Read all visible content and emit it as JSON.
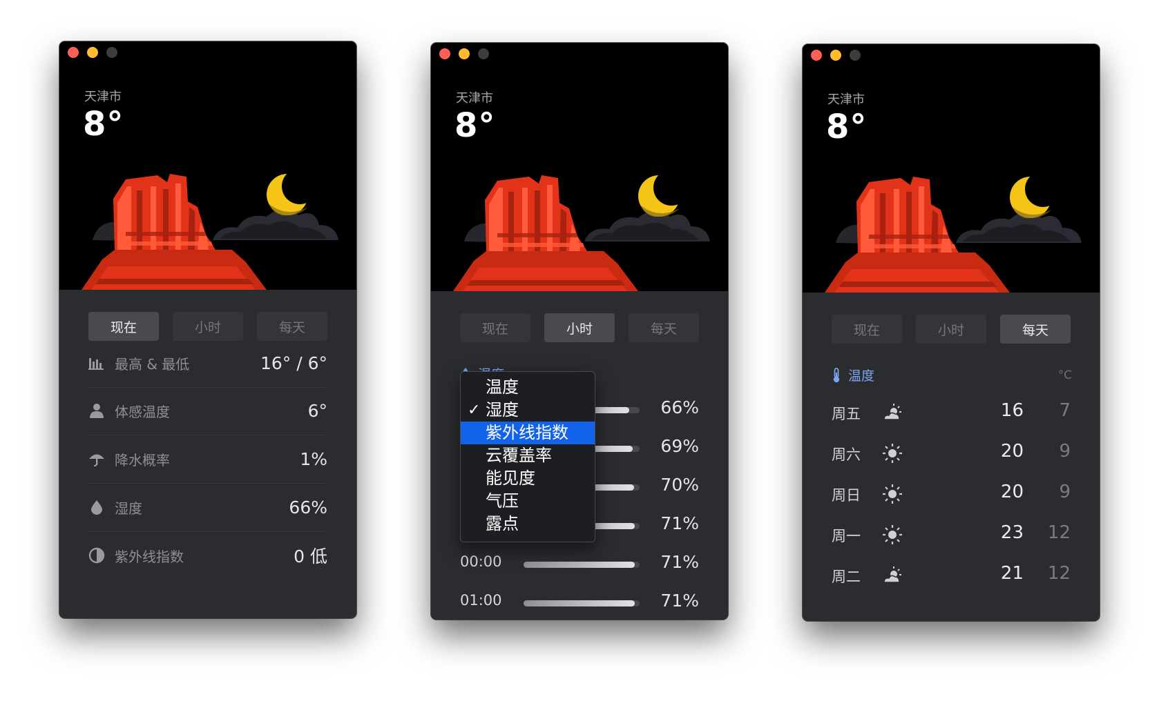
{
  "colors": {
    "window_bg": "#2b2c30",
    "hero_bg": "#000000",
    "accent_blue": "#7ba4f4",
    "menu_highlight": "#1362ea",
    "rock_red": "#e2331a",
    "moon_yellow": "#f4c516"
  },
  "windows": [
    {
      "city": "天津市",
      "temperature": "8°",
      "tabs": [
        {
          "label": "现在",
          "active": true
        },
        {
          "label": "小时",
          "active": false
        },
        {
          "label": "每天",
          "active": false
        }
      ],
      "rows": [
        {
          "icon": "bar-chart-icon",
          "label": "最高 & 最低",
          "value": "16° / 6°"
        },
        {
          "icon": "person-icon",
          "label": "体感温度",
          "value": "6°"
        },
        {
          "icon": "umbrella-icon",
          "label": "降水概率",
          "value": "1%"
        },
        {
          "icon": "drop-icon",
          "label": "湿度",
          "value": "66%"
        },
        {
          "icon": "half-circle-icon",
          "label": "紫外线指数",
          "value": "0 低"
        }
      ]
    },
    {
      "city": "天津市",
      "temperature": "8°",
      "tabs": [
        {
          "label": "现在",
          "active": false
        },
        {
          "label": "小时",
          "active": true
        },
        {
          "label": "每天",
          "active": false
        }
      ],
      "section_title": "湿度",
      "section_icon": "drop-icon",
      "hours": [
        {
          "time": "",
          "value": "66%",
          "fill": 0.66
        },
        {
          "time": "",
          "value": "69%",
          "fill": 0.69
        },
        {
          "time": "",
          "value": "70%",
          "fill": 0.7
        },
        {
          "time": "",
          "value": "71%",
          "fill": 0.71
        },
        {
          "time": "00:00",
          "value": "71%",
          "fill": 0.71
        },
        {
          "time": "01:00",
          "value": "71%",
          "fill": 0.71
        }
      ],
      "menu": {
        "items": [
          {
            "label": "温度",
            "checked": false,
            "highlighted": false
          },
          {
            "label": "湿度",
            "checked": true,
            "highlighted": false
          },
          {
            "label": "紫外线指数",
            "checked": false,
            "highlighted": true
          },
          {
            "label": "云覆盖率",
            "checked": false,
            "highlighted": false
          },
          {
            "label": "能见度",
            "checked": false,
            "highlighted": false
          },
          {
            "label": "气压",
            "checked": false,
            "highlighted": false
          },
          {
            "label": "露点",
            "checked": false,
            "highlighted": false
          }
        ],
        "checkmark": "✓"
      }
    },
    {
      "city": "天津市",
      "temperature": "8°",
      "tabs": [
        {
          "label": "现在",
          "active": false
        },
        {
          "label": "小时",
          "active": false
        },
        {
          "label": "每天",
          "active": true
        }
      ],
      "section_title": "温度",
      "section_icon": "thermometer-icon",
      "unit": "°C",
      "days": [
        {
          "day": "周五",
          "icon": "partly-cloudy-icon",
          "high": "16",
          "low": "7"
        },
        {
          "day": "周六",
          "icon": "sun-icon",
          "high": "20",
          "low": "9"
        },
        {
          "day": "周日",
          "icon": "sun-icon",
          "high": "20",
          "low": "9"
        },
        {
          "day": "周一",
          "icon": "sun-icon",
          "high": "23",
          "low": "12"
        },
        {
          "day": "周二",
          "icon": "partly-cloudy-icon",
          "high": "21",
          "low": "12"
        }
      ]
    }
  ]
}
